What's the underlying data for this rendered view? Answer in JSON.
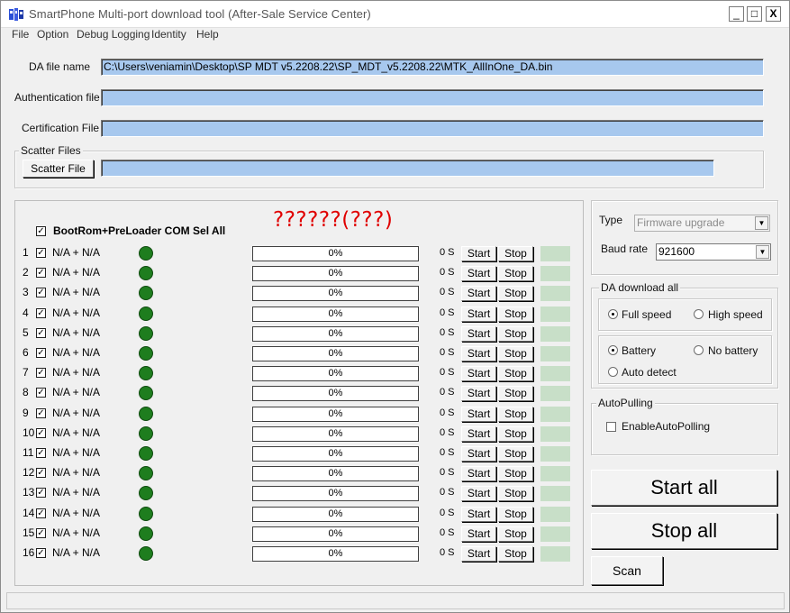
{
  "window": {
    "title": "SmartPhone Multi-port download tool (After-Sale Service Center)",
    "min_icon": "_",
    "max_icon": "□",
    "close_icon": "X"
  },
  "menu": [
    "File",
    "Option",
    "Debug Logging",
    "Identity",
    "Help"
  ],
  "files": {
    "da_label": "DA file name",
    "da_value": "C:\\Users\\veniamin\\Desktop\\SP MDT v5.2208.22\\SP_MDT_v5.2208.22\\MTK_AllInOne_DA.bin",
    "auth_label": "Authentication file",
    "auth_value": "",
    "cert_label": "Certification File",
    "cert_value": "",
    "scatter_group": "Scatter Files",
    "scatter_button": "Scatter File",
    "scatter_value": ""
  },
  "ports": {
    "select_all_label": "BootRom+PreLoader COM Sel All",
    "banner": "??????(???)",
    "rows": [
      {
        "num": "1",
        "label": "N/A + N/A",
        "progress": "0%",
        "time": "0 S"
      },
      {
        "num": "2",
        "label": "N/A + N/A",
        "progress": "0%",
        "time": "0 S"
      },
      {
        "num": "3",
        "label": "N/A + N/A",
        "progress": "0%",
        "time": "0 S"
      },
      {
        "num": "4",
        "label": "N/A + N/A",
        "progress": "0%",
        "time": "0 S"
      },
      {
        "num": "5",
        "label": "N/A + N/A",
        "progress": "0%",
        "time": "0 S"
      },
      {
        "num": "6",
        "label": "N/A + N/A",
        "progress": "0%",
        "time": "0 S"
      },
      {
        "num": "7",
        "label": "N/A + N/A",
        "progress": "0%",
        "time": "0 S"
      },
      {
        "num": "8",
        "label": "N/A + N/A",
        "progress": "0%",
        "time": "0 S"
      },
      {
        "num": "9",
        "label": "N/A + N/A",
        "progress": "0%",
        "time": "0 S"
      },
      {
        "num": "10",
        "label": "N/A + N/A",
        "progress": "0%",
        "time": "0 S"
      },
      {
        "num": "11",
        "label": "N/A + N/A",
        "progress": "0%",
        "time": "0 S"
      },
      {
        "num": "12",
        "label": "N/A + N/A",
        "progress": "0%",
        "time": "0 S"
      },
      {
        "num": "13",
        "label": "N/A + N/A",
        "progress": "0%",
        "time": "0 S"
      },
      {
        "num": "14",
        "label": "N/A + N/A",
        "progress": "0%",
        "time": "0 S"
      },
      {
        "num": "15",
        "label": "N/A + N/A",
        "progress": "0%",
        "time": "0 S"
      },
      {
        "num": "16",
        "label": "N/A + N/A",
        "progress": "0%",
        "time": "0 S"
      }
    ],
    "start_label": "Start",
    "stop_label": "Stop",
    "led_color": "#1e7d1e"
  },
  "settings": {
    "type_label": "Type",
    "type_value": "Firmware upgrade",
    "baud_label": "Baud rate",
    "baud_value": "921600",
    "da_group": "DA download all",
    "full_speed": "Full speed",
    "high_speed": "High speed",
    "battery": "Battery",
    "no_battery": "No battery",
    "auto_detect": "Auto detect",
    "autopull_group": "AutoPulling",
    "enable_autopull": "EnableAutoPolling"
  },
  "actions": {
    "start_all": "Start all",
    "stop_all": "Stop all",
    "scan": "Scan"
  }
}
